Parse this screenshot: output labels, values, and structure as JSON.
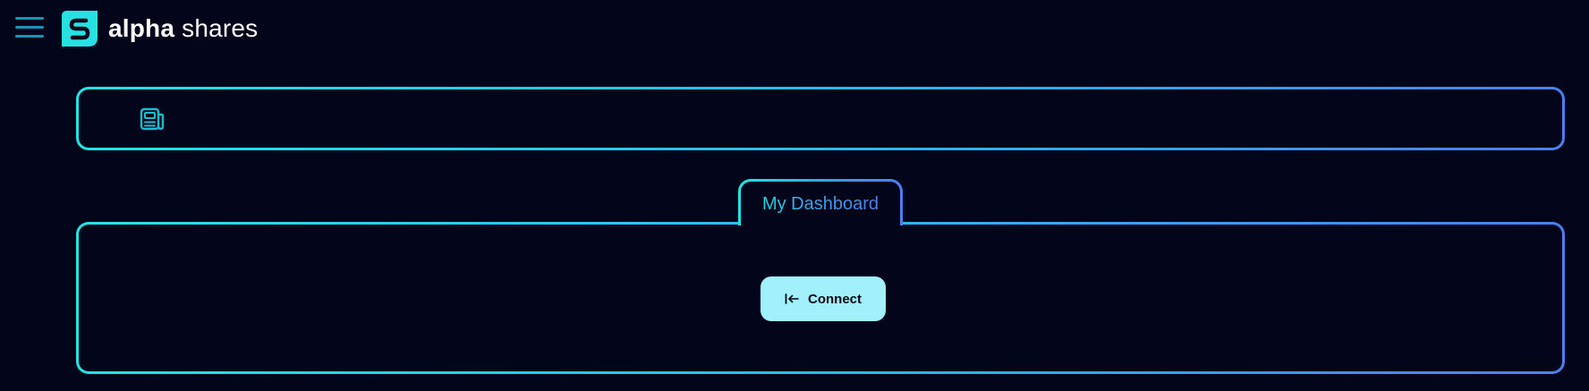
{
  "header": {
    "brand_bold": "alpha",
    "brand_light": "shares",
    "menu_icon": "hamburger-menu-icon",
    "logo_icon": "alpha-shares-logo-icon"
  },
  "news_bar": {
    "icon": "newspaper-icon"
  },
  "tabs": [
    {
      "label": "My Dashboard"
    }
  ],
  "main": {
    "connect_label": "Connect",
    "connect_icon": "login-arrow-icon"
  },
  "colors": {
    "background": "#03061a",
    "accent_cyan": "#21e4e6",
    "accent_blue": "#4a7ff2",
    "button_bg": "#a2f0fc",
    "menu_icon": "#1a93b8"
  }
}
